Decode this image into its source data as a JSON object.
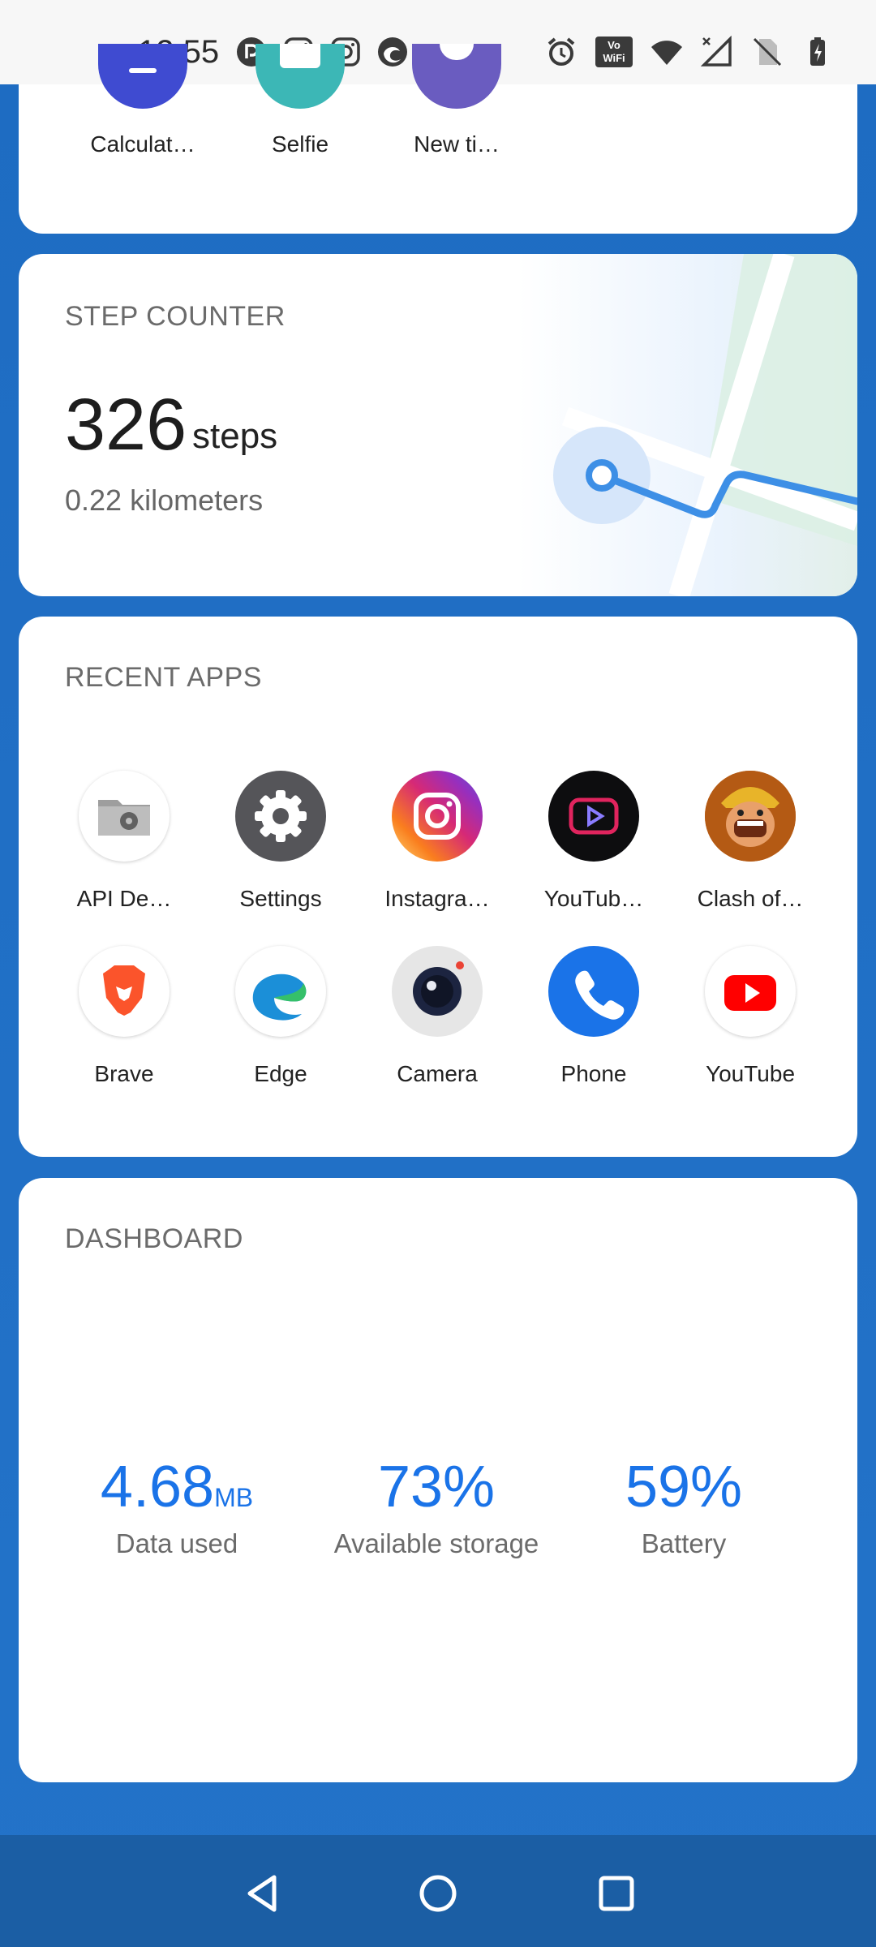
{
  "status_bar": {
    "time": "12:55",
    "left_icons": [
      "pocketcasts-icon",
      "instagram-icon",
      "instagram-icon",
      "edge-icon"
    ],
    "right_icons": [
      "alarm-icon",
      "vowifi-icon",
      "wifi-icon",
      "signal-icon",
      "no-sim-icon",
      "battery-charging-icon"
    ],
    "vowifi_text": "Vo WiFi"
  },
  "top_apps": [
    {
      "label": "Calculat…",
      "color": "#3f4bd1"
    },
    {
      "label": "Selfie",
      "color": "#3cb7b6"
    },
    {
      "label": "New ti…",
      "color": "#6a5cc0"
    }
  ],
  "step_counter": {
    "title": "STEP COUNTER",
    "steps": "326",
    "unit": "steps",
    "distance": "0.22 kilometers"
  },
  "recent_apps": {
    "title": "RECENT APPS",
    "apps": [
      {
        "label": "API De…",
        "icon": "folder-gear-icon"
      },
      {
        "label": "Settings",
        "icon": "gear-icon"
      },
      {
        "label": "Instagra…",
        "icon": "instagram-icon"
      },
      {
        "label": "YouTub…",
        "icon": "youtube-vanced-icon"
      },
      {
        "label": "Clash of…",
        "icon": "clash-of-clans-icon"
      },
      {
        "label": "Brave",
        "icon": "brave-icon"
      },
      {
        "label": "Edge",
        "icon": "edge-icon"
      },
      {
        "label": "Camera",
        "icon": "camera-icon"
      },
      {
        "label": "Phone",
        "icon": "phone-icon"
      },
      {
        "label": "YouTube",
        "icon": "youtube-icon"
      }
    ]
  },
  "dashboard": {
    "title": "DASHBOARD",
    "data_used_value": "4.68",
    "data_used_unit": "MB",
    "data_used_label": "Data used",
    "storage_value": "73%",
    "storage_label": "Available storage",
    "battery_value": "59%",
    "battery_label": "Battery"
  },
  "colors": {
    "background": "#1f6fc5",
    "accent": "#1a73e8"
  }
}
